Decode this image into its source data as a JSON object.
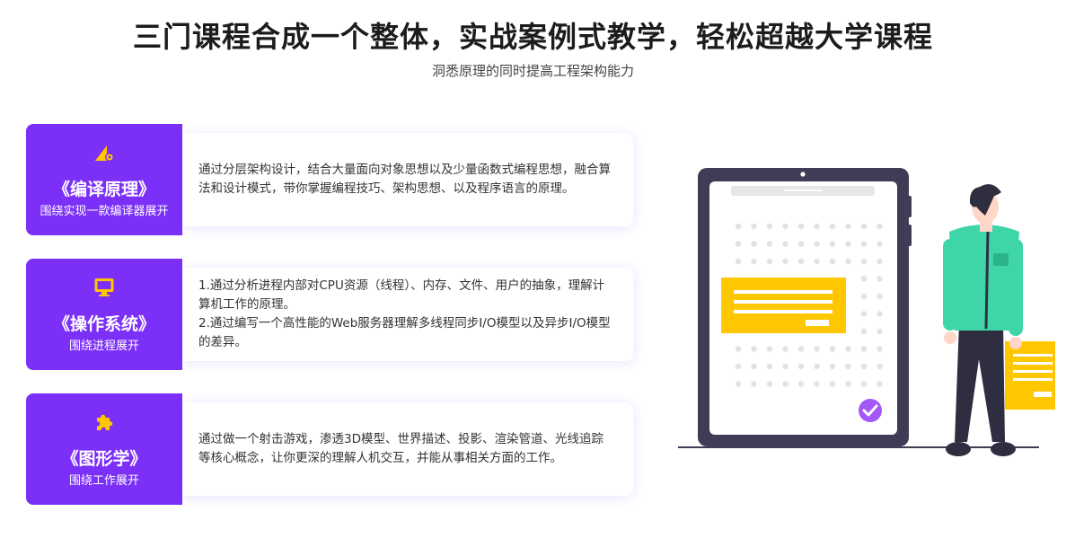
{
  "header": {
    "title": "三门课程合成一个整体，实战案例式教学，轻松超越大学课程",
    "subtitle": "洞悉原理的同时提高工程架构能力"
  },
  "courses": [
    {
      "name": "《编译原理》",
      "sub": "围绕实现一款编译器展开",
      "icon": "compiler-gear-icon",
      "desc": "通过分层架构设计，结合大量面向对象思想以及少量函数式编程思想，融合算法和设计模式，带你掌握编程技巧、架构思想、以及程序语言的原理。"
    },
    {
      "name": "《操作系统》",
      "sub": "围绕进程展开",
      "icon": "monitor-icon",
      "desc": "1.通过分析进程内部对CPU资源（线程）、内存、文件、用户的抽象，理解计算机工作的原理。\n2.通过编写一个高性能的Web服务器理解多线程同步I/O模型以及异步I/O模型的差异。"
    },
    {
      "name": "《图形学》",
      "sub": "围绕工作展开",
      "icon": "puzzle-icon",
      "desc": "通过做一个射击游戏，渗透3D模型、世界描述、投影、渲染管道、光线追踪等核心概念，让你更深的理解人机交互，并能从事相关方面的工作。"
    }
  ],
  "colors": {
    "accent": "#7b2ff7",
    "icon": "#ffc700",
    "shirt": "#3ed6a8",
    "device": "#3f3d56"
  }
}
